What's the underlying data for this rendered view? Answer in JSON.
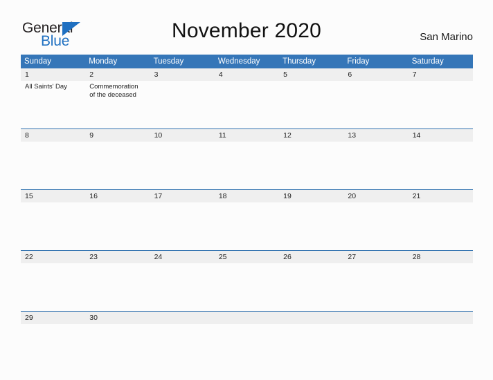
{
  "brand": {
    "name_part1": "General",
    "name_part2": "Blue",
    "logo_icon": "triangle-icon",
    "accent_color": "#1f70c1"
  },
  "header": {
    "title": "November 2020",
    "location": "San Marino"
  },
  "colors": {
    "header_blue": "#3576b8",
    "rule_blue": "#2c6fae",
    "date_band_gray": "#efefef",
    "page_background": "#fcfcfc"
  },
  "calendar": {
    "month": "November",
    "year": "2020",
    "weekday_headers": [
      "Sunday",
      "Monday",
      "Tuesday",
      "Wednesday",
      "Thursday",
      "Friday",
      "Saturday"
    ],
    "weeks": [
      {
        "dates": [
          "1",
          "2",
          "3",
          "4",
          "5",
          "6",
          "7"
        ],
        "events": [
          "All Saints' Day",
          "Commemoration of the deceased",
          "",
          "",
          "",
          "",
          ""
        ]
      },
      {
        "dates": [
          "8",
          "9",
          "10",
          "11",
          "12",
          "13",
          "14"
        ],
        "events": [
          "",
          "",
          "",
          "",
          "",
          "",
          ""
        ]
      },
      {
        "dates": [
          "15",
          "16",
          "17",
          "18",
          "19",
          "20",
          "21"
        ],
        "events": [
          "",
          "",
          "",
          "",
          "",
          "",
          ""
        ]
      },
      {
        "dates": [
          "22",
          "23",
          "24",
          "25",
          "26",
          "27",
          "28"
        ],
        "events": [
          "",
          "",
          "",
          "",
          "",
          "",
          ""
        ]
      },
      {
        "dates": [
          "29",
          "30",
          "",
          "",
          "",
          "",
          ""
        ],
        "events": [
          "",
          "",
          "",
          "",
          "",
          "",
          ""
        ]
      }
    ]
  }
}
